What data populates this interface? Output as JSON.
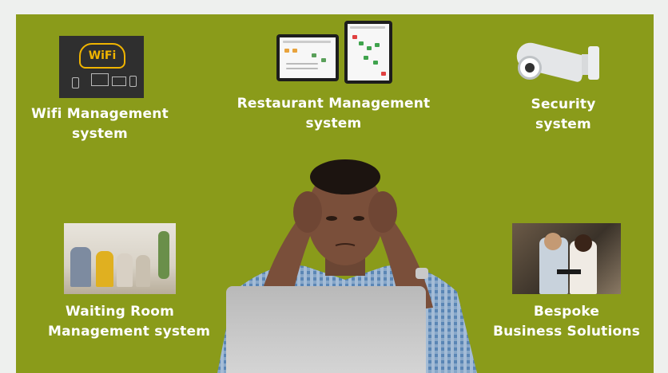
{
  "colors": {
    "panel": "#8a9b1a",
    "text": "#ffffff",
    "page": "#eef0ee"
  },
  "items": {
    "wifi": {
      "icon": "wifi-cloud-icon",
      "thumb_text": "WiFi",
      "line1": "Wifi Management",
      "line2": "system"
    },
    "restaurant": {
      "icon": "tablet-icon",
      "line1": "Restaurant Management",
      "line2": "system"
    },
    "security": {
      "icon": "cctv-camera-icon",
      "line1": "Security",
      "line2": "system"
    },
    "waiting": {
      "icon": "waiting-room-photo",
      "line1": "Waiting Room",
      "line2": "Management system"
    },
    "bespoke": {
      "icon": "business-people-photo",
      "line1": "Bespoke",
      "line2": "Business Solutions"
    }
  }
}
